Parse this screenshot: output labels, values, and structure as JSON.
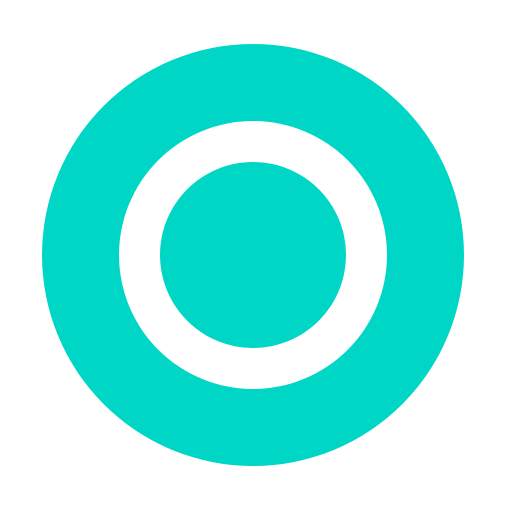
{
  "app_icon": {
    "icon_name": "circle-ring-dot-icon",
    "colors": {
      "background": "#ffffff",
      "accent": "#00d6c6",
      "ring_gap": "#ffffff"
    }
  }
}
